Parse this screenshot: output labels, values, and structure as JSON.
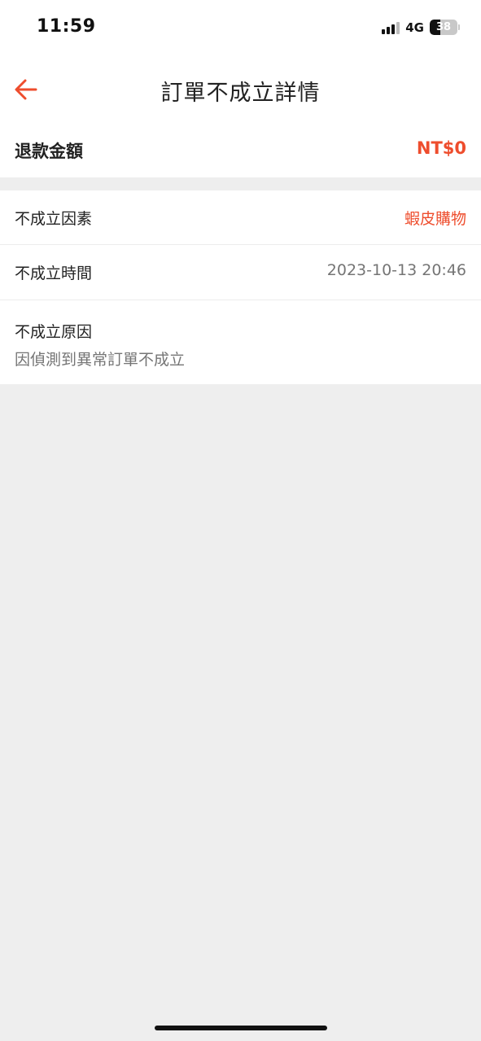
{
  "status_bar": {
    "time": "11:59",
    "network": "4G",
    "signal_icon": "signal-bars-icon",
    "battery_icon": "battery-icon",
    "battery_level": "38"
  },
  "header": {
    "back_icon": "arrow-left-icon",
    "title": "訂單不成立詳情"
  },
  "refund": {
    "label": "退款金額",
    "amount": "NT$0"
  },
  "details": {
    "factor_label": "不成立因素",
    "factor_value": "蝦皮購物",
    "time_label": "不成立時間",
    "time_value": "2023-10-13 20:46",
    "reason_label": "不成立原因",
    "reason_value": "因偵測到異常訂單不成立"
  },
  "colors": {
    "accent": "#ee4d2d",
    "background": "#eeeeee",
    "secondary_text": "#757575"
  }
}
